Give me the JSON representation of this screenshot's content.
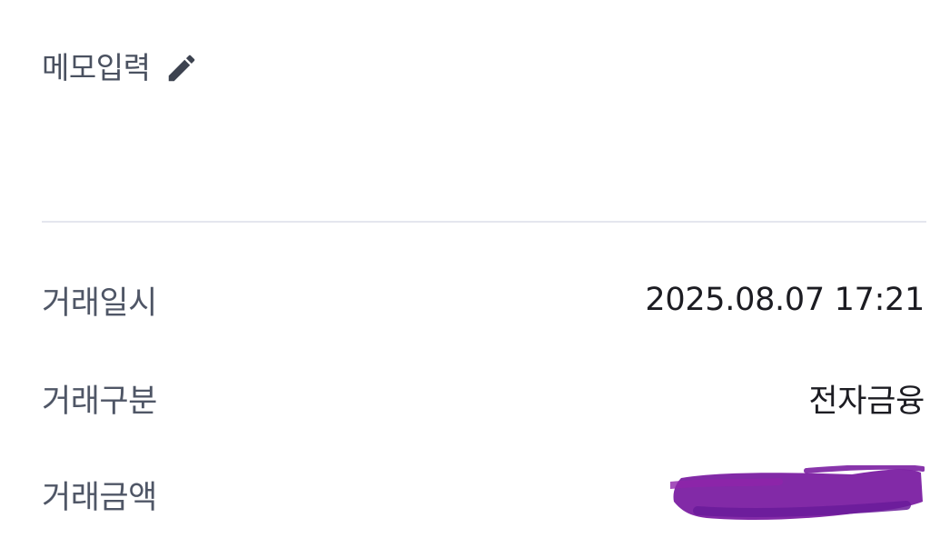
{
  "memo": {
    "label": "메모입력",
    "icon": "pencil-icon"
  },
  "details": {
    "datetime": {
      "label": "거래일시",
      "value": "2025.08.07 17:21"
    },
    "type": {
      "label": "거래구분",
      "value": "전자금융"
    },
    "amount": {
      "label": "거래금액",
      "redaction_color": "#7b1fa2"
    }
  },
  "colors": {
    "label_text": "#4f5666",
    "value_text": "#1c1c22",
    "divider": "#e4e6ee",
    "icon": "#3d4350"
  }
}
